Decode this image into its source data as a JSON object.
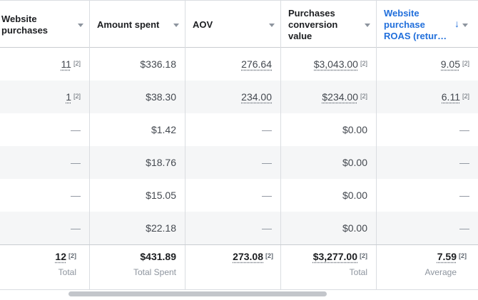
{
  "columns": [
    {
      "label": "Website\npurchases"
    },
    {
      "label": "Amount spent"
    },
    {
      "label": "AOV"
    },
    {
      "label": "Purchases\nconversion\nvalue"
    },
    {
      "label": "Website\npurchase\nROAS (retur…"
    }
  ],
  "sort_indicator": "↓",
  "rows": [
    {
      "purchases": "11",
      "spent": "$336.18",
      "aov": "276.64",
      "conv_value": "$3,043.00",
      "roas": "9.05"
    },
    {
      "purchases": "1",
      "spent": "$38.30",
      "aov": "234.00",
      "conv_value": "$234.00",
      "roas": "6.11"
    },
    {
      "purchases": "—",
      "spent": "$1.42",
      "aov": "—",
      "conv_value": "$0.00",
      "roas": "—"
    },
    {
      "purchases": "—",
      "spent": "$18.76",
      "aov": "—",
      "conv_value": "$0.00",
      "roas": "—"
    },
    {
      "purchases": "—",
      "spent": "$15.05",
      "aov": "—",
      "conv_value": "$0.00",
      "roas": "—"
    },
    {
      "purchases": "—",
      "spent": "$22.18",
      "aov": "—",
      "conv_value": "$0.00",
      "roas": "—"
    }
  ],
  "footnote_marker": "[2]",
  "totals": {
    "purchases": {
      "value": "12",
      "label": "Total"
    },
    "spent": {
      "value": "$431.89",
      "label": "Total Spent"
    },
    "aov": {
      "value": "273.08",
      "label": ""
    },
    "conv_value": {
      "value": "$3,277.00",
      "label": "Total"
    },
    "roas": {
      "value": "7.59",
      "label": "Average"
    }
  },
  "colors": {
    "accent": "#216fdb",
    "row_shade": "#f5f6f7",
    "border": "#dadde1"
  }
}
